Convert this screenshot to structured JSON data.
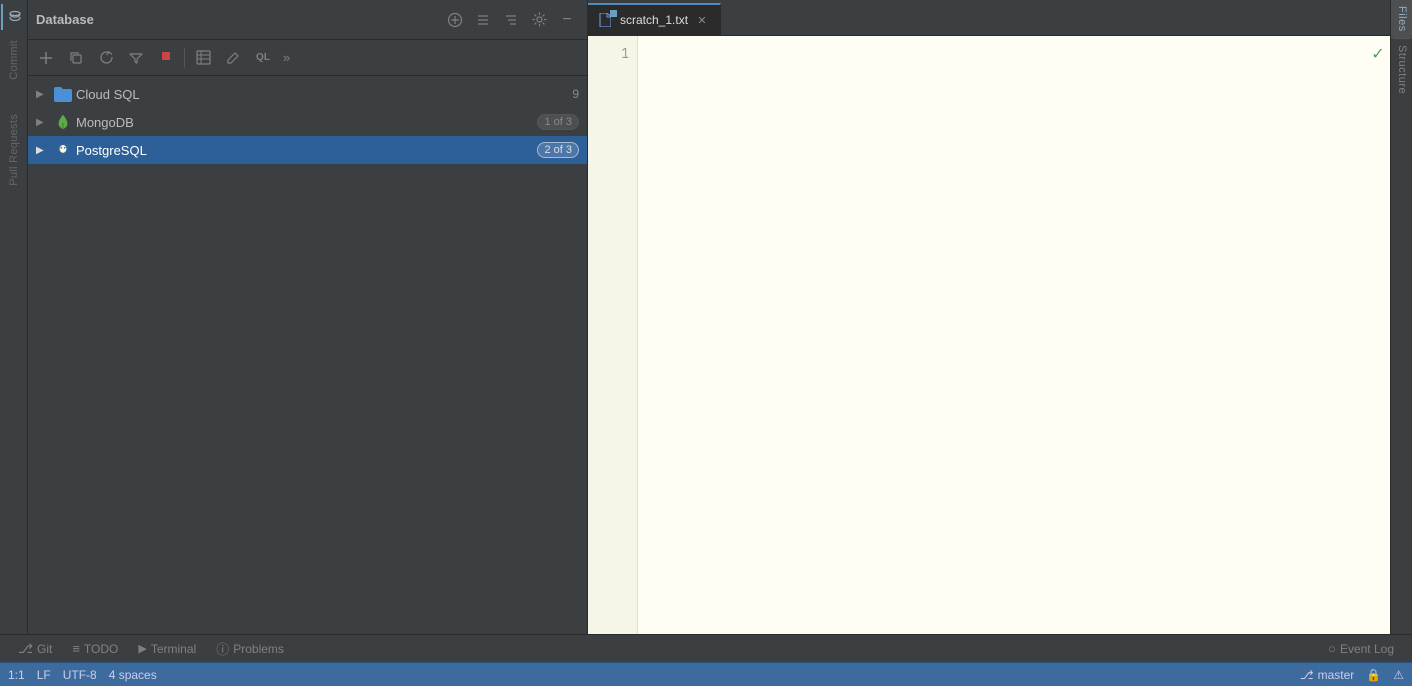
{
  "app": {
    "title": "Database"
  },
  "header": {
    "title": "Database",
    "icons": {
      "plus": "+",
      "collapse_all": "≡",
      "expand_all": "≡",
      "settings": "⚙",
      "minimize": "−"
    }
  },
  "toolbar": {
    "add_label": "+",
    "copy_label": "⧉",
    "refresh_label": "↻",
    "filter_label": "⧉",
    "stop_label": "■",
    "table_label": "▦",
    "edit_label": "✎",
    "query_label": "QL",
    "more_label": "»"
  },
  "tree": {
    "items": [
      {
        "id": "cloud-sql",
        "label": "Cloud SQL",
        "badge": "9",
        "badge_type": "plain",
        "icon_type": "folder",
        "expanded": false
      },
      {
        "id": "mongodb",
        "label": "MongoDB",
        "badge": "1 of 3",
        "badge_type": "pill",
        "icon_type": "mongo",
        "expanded": false
      },
      {
        "id": "postgresql",
        "label": "PostgreSQL",
        "badge": "2 of 3",
        "badge_type": "pill",
        "icon_type": "pg",
        "expanded": false,
        "selected": true
      }
    ]
  },
  "tabs": [
    {
      "id": "scratch_1",
      "label": "scratch_1.txt",
      "active": true,
      "has_badge": true
    }
  ],
  "editor": {
    "line_number": "1",
    "content": ""
  },
  "left_sidebar": {
    "items": [
      {
        "id": "database",
        "label": "Database",
        "active": true
      },
      {
        "id": "commit",
        "label": "Commit",
        "active": false
      },
      {
        "id": "pull_requests",
        "label": "Pull Requests",
        "active": false
      }
    ]
  },
  "right_sidebar": {
    "items": [
      {
        "id": "files",
        "label": "Files",
        "active": true
      },
      {
        "id": "structure",
        "label": "Structure",
        "active": false
      }
    ]
  },
  "bottom_toolbar": {
    "tabs": [
      {
        "id": "git",
        "label": "Git",
        "icon": "⎇"
      },
      {
        "id": "todo",
        "label": "TODO",
        "icon": "≡"
      },
      {
        "id": "terminal",
        "label": "Terminal",
        "icon": "▶"
      },
      {
        "id": "problems",
        "label": "Problems",
        "icon": "ⓘ"
      },
      {
        "id": "event_log",
        "label": "Event Log",
        "icon": "○"
      }
    ]
  },
  "status_bar": {
    "position": "1:1",
    "line_ending": "LF",
    "encoding": "UTF-8",
    "indent": "4 spaces",
    "branch": "master",
    "lock_icon": "🔒",
    "warn_icon": "⚠"
  }
}
